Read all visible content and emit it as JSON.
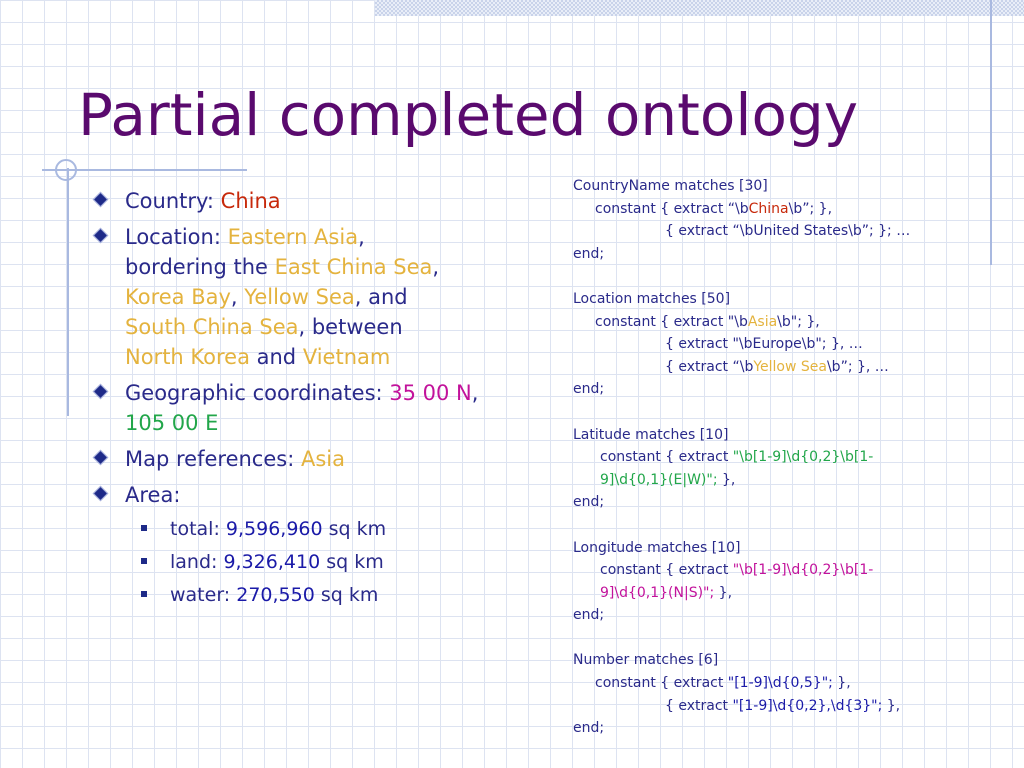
{
  "slide": {
    "title": "Partial completed ontology"
  },
  "bullets": {
    "country_label": "Country: ",
    "country_value": "China",
    "location_label": "Location: ",
    "location_eastern_asia": "Eastern Asia",
    "location_sep1": ",",
    "location_bordering": "bordering the ",
    "location_east_china_sea": "East China Sea",
    "location_sep2": ",",
    "location_korea_bay": "Korea Bay",
    "location_sep3": ", ",
    "location_yellow_sea": "Yellow Sea",
    "location_and1": ", and",
    "location_south_china_sea": "South China Sea",
    "location_between": ", between",
    "location_north_korea": "North Korea",
    "location_and2": " and ",
    "location_vietnam": "Vietnam",
    "geo_label": "Geographic coordinates: ",
    "geo_lat": "35 00 N",
    "geo_sep": ", ",
    "geo_lon": "105 00 E",
    "map_label": "Map references: ",
    "map_value": "Asia",
    "area_label": "Area:",
    "area_items": [
      {
        "label": "total: ",
        "value": "9,596,960",
        "unit": " sq km"
      },
      {
        "label": "land: ",
        "value": "9,326,410",
        "unit": " sq km"
      },
      {
        "label": "water: ",
        "value": "270,550",
        "unit": " sq km"
      }
    ]
  },
  "code": {
    "country_head": "CountryName matches [30]",
    "country_c1_pre": "constant { extract “\\b",
    "country_c1_hl": "China",
    "country_c1_post": "\\b”; },",
    "country_c2": "{ extract “\\bUnited States\\b”; }; …",
    "end": "end;",
    "location_head": "Location matches [50]",
    "location_c1_pre": "constant { extract \"\\b",
    "location_c1_hl": "Asia",
    "location_c1_post": "\\b\"; },",
    "location_c2": "{ extract \"\\bEurope\\b\"; }, …",
    "location_c3_pre": "{ extract “\\b",
    "location_c3_hl": "Yellow Sea",
    "location_c3_post": "\\b”; }, …",
    "latitude_head": "Latitude matches [10]",
    "latitude_c_pre": "constant { extract ",
    "latitude_c_hl1": "\"\\b[1-9]\\d{0,2}\\b[1-",
    "latitude_c_hl2": "9]\\d{0,1}(E|W)\";",
    "latitude_c_post": " },",
    "longitude_head": "Longitude matches [10]",
    "longitude_c_pre": "constant { extract ",
    "longitude_c_hl1": "\"\\b[1-9]\\d{0,2}\\b[1-",
    "longitude_c_hl2": "9]\\d{0,1}(N|S)\";",
    "longitude_c_post": " },",
    "number_head": "Number matches [6]",
    "number_c1_pre": "constant { extract ",
    "number_c1_hl": "\"[1-9]\\d{0,5}\";",
    "number_c1_post": " },",
    "number_c2_pre": "{ extract ",
    "number_c2_hl": "\"[1-9]\\d{0,2},\\d{3}\";",
    "number_c2_post": " },"
  },
  "colors": {
    "title": "#5a0a6e",
    "body_text": "#2a2a8a",
    "country_value": "#c7290b",
    "location_values": "#e4b33e",
    "latitude": "#c2129b",
    "longitude": "#22a64a",
    "numbers": "#1a1aa8"
  }
}
